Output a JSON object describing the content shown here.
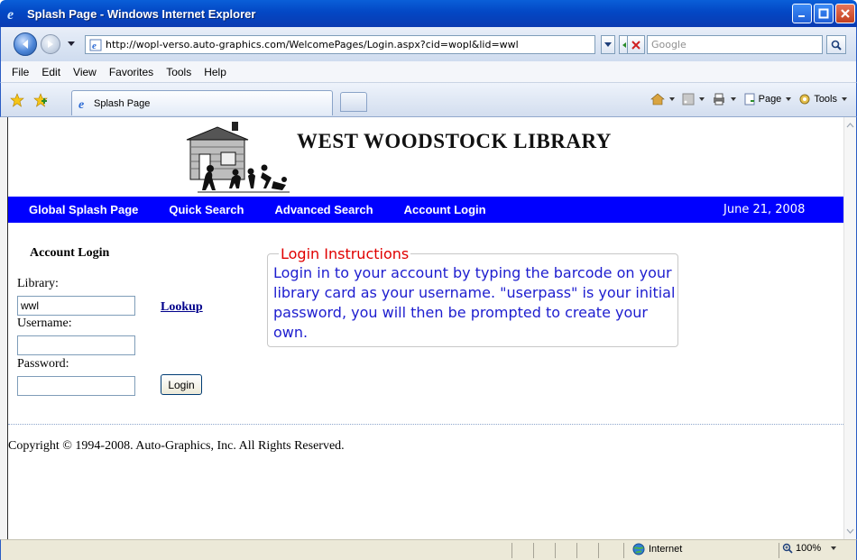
{
  "window": {
    "title": "Splash Page - Windows Internet Explorer",
    "icon": "ie-logo-icon"
  },
  "address_bar": {
    "url": "http://wopl-verso.auto-graphics.com/WelcomePages/Login.aspx?cid=wopl&lid=wwl",
    "search_placeholder": "Google"
  },
  "menu": {
    "items": [
      "File",
      "Edit",
      "View",
      "Favorites",
      "Tools",
      "Help"
    ]
  },
  "tabs": {
    "active_tab": "Splash Page",
    "commands": [
      "Page",
      "Tools"
    ]
  },
  "page": {
    "library_name": "WEST WOODSTOCK LIBRARY",
    "nav": {
      "global_splash": "Global Splash Page",
      "quick_search": "Quick Search",
      "advanced_search": "Advanced Search",
      "account_login": "Account Login",
      "date": "June 21, 2008"
    },
    "form": {
      "heading": "Account Login",
      "library_label": "Library:",
      "library_value": "wwl",
      "lookup_label": "Lookup",
      "username_label": "Username:",
      "username_value": "",
      "password_label": "Password:",
      "password_value": "",
      "login_button": "Login"
    },
    "instructions": {
      "title": "Login Instructions",
      "text": "Login in to your account by typing the barcode on your library card as your username. \"userpass\" is your initial password, you will then be prompted to create your own."
    },
    "copyright": "Copyright © 1994-2008. Auto-Graphics, Inc. All Rights Reserved."
  },
  "status_bar": {
    "zone": "Internet",
    "zoom": "100%"
  },
  "colors": {
    "nav_blue": "#0000ff",
    "instructions_title": "#e00000",
    "instructions_text": "#1d1dcf",
    "titlebar_blue": "#0347c4"
  }
}
